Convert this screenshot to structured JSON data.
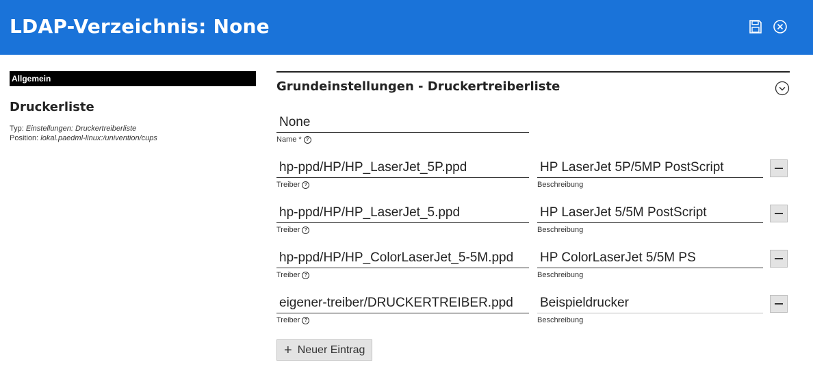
{
  "header": {
    "title": "LDAP-Verzeichnis: None",
    "accent": "#1a73d9"
  },
  "sidebar": {
    "tab_label": "Allgemein",
    "object_title": "Druckerliste",
    "type_label": "Typ:",
    "type_value": "Einstellungen: Druckertreiberliste",
    "position_label": "Position:",
    "position_value": "lokal.paedml-linux:/univention/cups"
  },
  "section": {
    "title": "Grundeinstellungen - Druckertreiberliste"
  },
  "name_field": {
    "value": "None",
    "label": "Name *"
  },
  "entries": [
    {
      "driver": "hp-ppd/HP/HP_LaserJet_5P.ppd",
      "driver_label": "Treiber",
      "description": "HP LaserJet 5P/5MP PostScript",
      "description_label": "Beschreibung"
    },
    {
      "driver": "hp-ppd/HP/HP_LaserJet_5.ppd",
      "driver_label": "Treiber",
      "description": "HP LaserJet 5/5M PostScript",
      "description_label": "Beschreibung"
    },
    {
      "driver": "hp-ppd/HP/HP_ColorLaserJet_5-5M.ppd",
      "driver_label": "Treiber",
      "description": "HP ColorLaserJet 5/5M PS",
      "description_label": "Beschreibung"
    },
    {
      "driver": "eigener-treiber/DRUCKERTREIBER.ppd",
      "driver_label": "Treiber",
      "description": "Beispieldrucker",
      "description_label": "Beschreibung"
    }
  ],
  "add_button": {
    "label": "Neuer Eintrag"
  },
  "icons": {
    "save": "save-icon",
    "close": "close-circle-icon",
    "collapse": "chevron-down-circle-icon",
    "help": "help-icon",
    "remove": "minus-icon",
    "add": "plus-icon"
  }
}
